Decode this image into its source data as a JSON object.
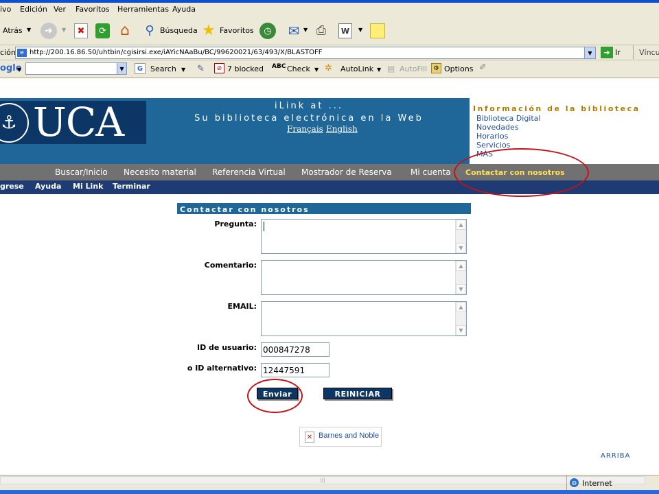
{
  "menu": [
    "ivo",
    "Edición",
    "Ver",
    "Favoritos",
    "Herramientas",
    "Ayuda"
  ],
  "toolbar": {
    "back": "Atrás",
    "search": "Búsqueda",
    "favorites": "Favoritos"
  },
  "address": {
    "label": "ción",
    "url": "http://200.16.86.50/uhtbin/cgisirsi.exe/iAYicNAaBu/BC/99620021/63/493/X/BLASTOFF",
    "go": "Ir",
    "links": "Víncul"
  },
  "googlebar": {
    "brand": "ogle",
    "search": "Search",
    "blocked": "7 blocked",
    "check": "Check",
    "autolink": "AutoLink",
    "autofill": "AutoFill",
    "options": "Options"
  },
  "header": {
    "logo_text": "UCA",
    "ilink": "iLink at ...",
    "tagline": "Su biblioteca electrónica en la Web",
    "lang_fr": "Français",
    "lang_en": "English"
  },
  "info": {
    "title": "Información de la biblioteca",
    "links": [
      "Biblioteca Digital",
      "Novedades",
      "Horarios",
      "Servicios",
      "MÁS"
    ]
  },
  "nav": [
    "Buscar/Inicio",
    "Necesito material",
    "Referencia Virtual",
    "Mostrador de Reserva",
    "Mi cuenta",
    "Contactar con nosotros"
  ],
  "subnav": [
    "grese",
    "Ayuda",
    "Mi Link",
    "Terminar"
  ],
  "form": {
    "title": "Contactar con nosotros",
    "pregunta": "Pregunta:",
    "comentario": "Comentario:",
    "email": "EMAIL:",
    "user_id_label": "ID de usuario:",
    "user_id_value": "000847278",
    "alt_id_label": "o ID alternativo:",
    "alt_id_value": "12447591",
    "send": "Enviar",
    "reset": "REINICIAR"
  },
  "partner": "Barnes and Noble",
  "top_link": "ARRIBA",
  "status": {
    "zone": "Internet"
  },
  "colors": {
    "header_blue": "#1f6699",
    "nav_gray": "#717171",
    "subnav_navy": "#1e3b73",
    "highlight_yellow": "#ffe15a",
    "annotation_red": "#c4121b"
  }
}
